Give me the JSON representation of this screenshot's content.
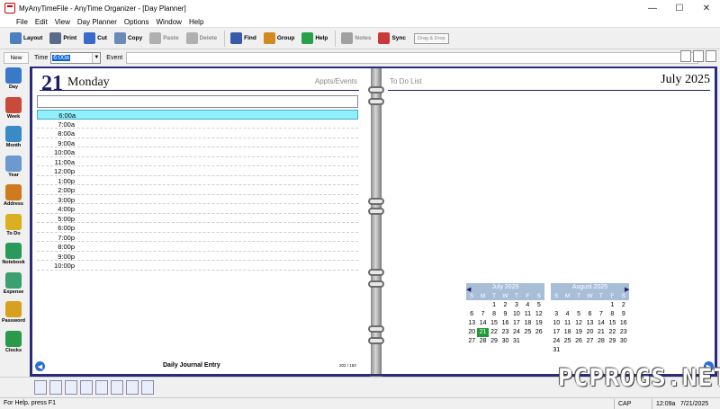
{
  "window": {
    "title": "MyAnyTimeFile - AnyTime Organizer - [Day Planner]",
    "minimize": "—",
    "maximize": "☐",
    "close": "✕"
  },
  "menu": [
    "File",
    "Edit",
    "View",
    "Day Planner",
    "Options",
    "Window",
    "Help"
  ],
  "toolbar": [
    {
      "label": "Layout",
      "icon": "layout-icon",
      "color": "#4a7fc0",
      "enabled": true
    },
    {
      "label": "Print",
      "icon": "printer-icon",
      "color": "#5a6a8a",
      "enabled": true
    },
    {
      "label": "Cut",
      "icon": "scissors-icon",
      "color": "#3a6ac8",
      "enabled": true
    },
    {
      "label": "Copy",
      "icon": "copy-icon",
      "color": "#6a8ab8",
      "enabled": true
    },
    {
      "label": "Paste",
      "icon": "paste-icon",
      "color": "#b0b0b0",
      "enabled": false
    },
    {
      "label": "Delete",
      "icon": "delete-icon",
      "color": "#b0b0b0",
      "enabled": false
    },
    {
      "label": "Find",
      "icon": "magnifier-icon",
      "color": "#3a5aa8",
      "enabled": true
    },
    {
      "label": "Group",
      "icon": "group-icon",
      "color": "#d08a20",
      "enabled": true
    },
    {
      "label": "Help",
      "icon": "help-icon",
      "color": "#2aa04a",
      "enabled": true
    },
    {
      "label": "Notes",
      "icon": "notes-icon",
      "color": "#a0a0a0",
      "enabled": false
    },
    {
      "label": "Sync",
      "icon": "sync-icon",
      "color": "#c83a3a",
      "enabled": true
    }
  ],
  "toolbar_dragdrop": "Drag & Drop",
  "entry": {
    "new_label": "New",
    "time_label": "Time",
    "time_value": "6:00a",
    "event_label": "Event"
  },
  "leftnav": [
    {
      "label": "Day",
      "icon": "clock-icon",
      "color": "#3a78c8"
    },
    {
      "label": "Week",
      "icon": "week-calendar-icon",
      "color": "#c84a3a"
    },
    {
      "label": "Month",
      "icon": "month-calendar-icon",
      "color": "#3a8ac8"
    },
    {
      "label": "Year",
      "icon": "year-calendar-icon",
      "color": "#6a9ad0"
    },
    {
      "label": "Address",
      "icon": "address-book-icon",
      "color": "#d07a20"
    },
    {
      "label": "To Do",
      "icon": "todo-list-icon",
      "color": "#d8b020"
    },
    {
      "label": "Notebook",
      "icon": "notebook-icon",
      "color": "#2a9a5a"
    },
    {
      "label": "Expense",
      "icon": "expense-icon",
      "color": "#3aa070"
    },
    {
      "label": "Password",
      "icon": "key-icon",
      "color": "#d8a020"
    },
    {
      "label": "Clocks",
      "icon": "clocks-icon",
      "color": "#2a9a4a"
    }
  ],
  "day": {
    "number": "21",
    "name": "Monday",
    "appts_label": "Appts/Events",
    "journal_label": "Daily Journal Entry",
    "page_number": "202 / 163"
  },
  "timeslots": [
    "6:00a",
    "7:00a",
    "8:00a",
    "9:00a",
    "10:00a",
    "11:00a",
    "12:00p",
    "1:00p",
    "2:00p",
    "3:00p",
    "4:00p",
    "5:00p",
    "6:00p",
    "7:00p",
    "8:00p",
    "9:00p",
    "10:00p"
  ],
  "selected_slot": "6:00a",
  "right": {
    "todo_label": "To Do List",
    "month_year": "July 2025"
  },
  "minicalendars": [
    {
      "title": "July 2025",
      "dow": [
        "S",
        "M",
        "T",
        "W",
        "T",
        "F",
        "S"
      ],
      "lead_blanks": 2,
      "days": 31,
      "today": 21
    },
    {
      "title": "August 2025",
      "dow": [
        "S",
        "M",
        "T",
        "W",
        "T",
        "F",
        "S"
      ],
      "lead_blanks": 5,
      "days": 31,
      "today": null
    }
  ],
  "status": {
    "help": "For Help, press F1",
    "cap": "CAP",
    "time": "12:09a",
    "date": "7/21/2025"
  },
  "watermark": "PCPROGS.NET"
}
